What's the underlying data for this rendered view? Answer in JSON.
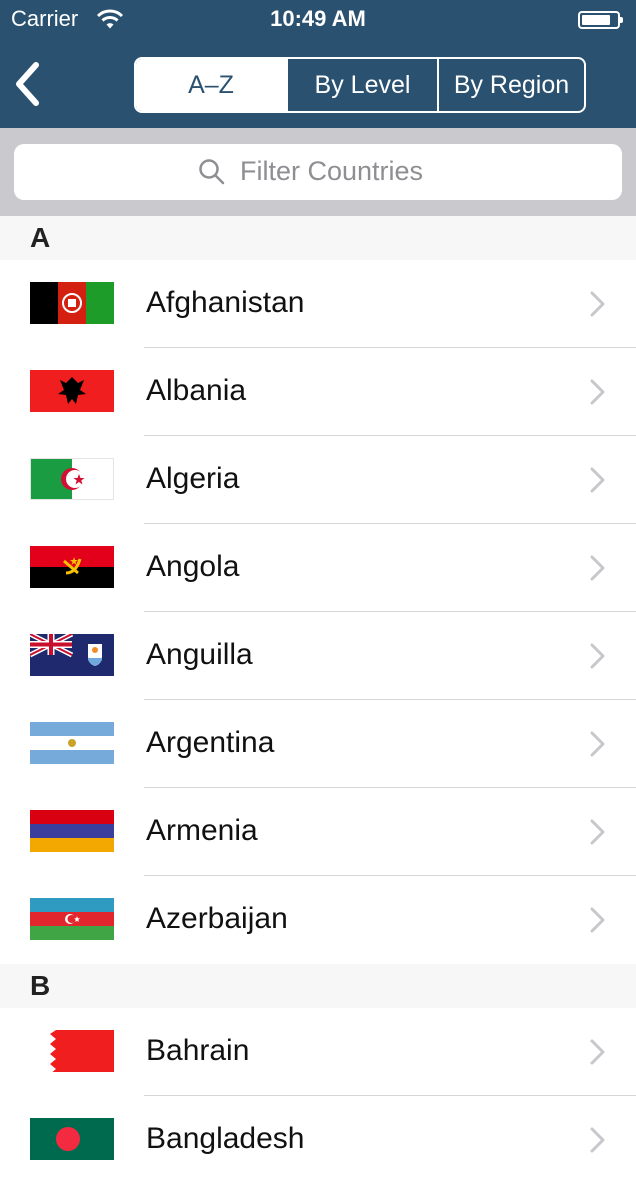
{
  "status_bar": {
    "carrier": "Carrier",
    "time": "10:49 AM"
  },
  "nav": {
    "back_icon": "chevron-left-icon",
    "segments": [
      "A–Z",
      "By Level",
      "By Region"
    ],
    "selected_segment": "A–Z"
  },
  "search": {
    "placeholder": "Filter Countries",
    "icon": "magnifier-icon"
  },
  "sections": [
    {
      "letter": "A",
      "countries": [
        "Afghanistan",
        "Albania",
        "Algeria",
        "Angola",
        "Anguilla",
        "Argentina",
        "Armenia",
        "Azerbaijan"
      ]
    },
    {
      "letter": "B",
      "countries": [
        "Bahrain",
        "Bangladesh"
      ]
    }
  ],
  "colors": {
    "nav_background": "#2a5170",
    "search_background": "#c9c9ce",
    "section_background": "#f7f7f7",
    "chevron": "#c7c7cc"
  }
}
